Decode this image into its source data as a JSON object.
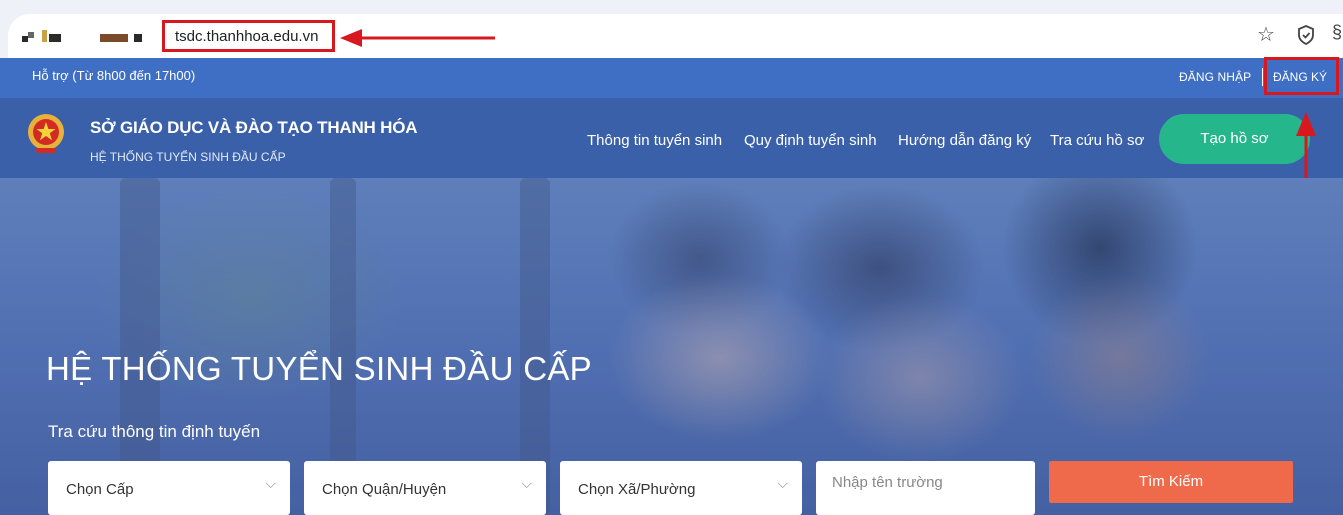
{
  "browser": {
    "url": "tsdc.thanhhoa.edu.vn",
    "star_icon": "star-icon",
    "shield_icon": "shield-icon"
  },
  "top_strip": {
    "support": "Hỗ trợ (Từ 8h00 đến 17h00)",
    "login": "ĐĂNG NHẬP",
    "register": "ĐĂNG KÝ"
  },
  "header": {
    "org_title": "SỞ GIÁO DỤC VÀ ĐÀO TẠO THANH HÓA",
    "org_sub": "HỆ THỐNG TUYỂN SINH ĐẦU CẤP",
    "nav": [
      "Thông tin tuyển sinh",
      "Quy định tuyển sinh",
      "Hướng dẫn đăng ký",
      "Tra cứu hồ sơ"
    ],
    "create_button": "Tạo hồ sơ"
  },
  "hero": {
    "title": "HỆ THỐNG TUYỂN SINH ĐẦU CẤP",
    "subtitle": "Tra cứu thông tin định tuyến",
    "select_level": "Chọn Cấp",
    "select_district": "Chọn Quận/Huyện",
    "select_ward": "Chọn Xã/Phường",
    "school_placeholder": "Nhập tên trường",
    "search_button": "Tìm Kiếm"
  },
  "colors": {
    "annotation": "#d7191f",
    "strip": "#3f6fc5",
    "header": "#3960a9",
    "create_button": "#26b68b",
    "search_button": "#ef6a4b"
  }
}
